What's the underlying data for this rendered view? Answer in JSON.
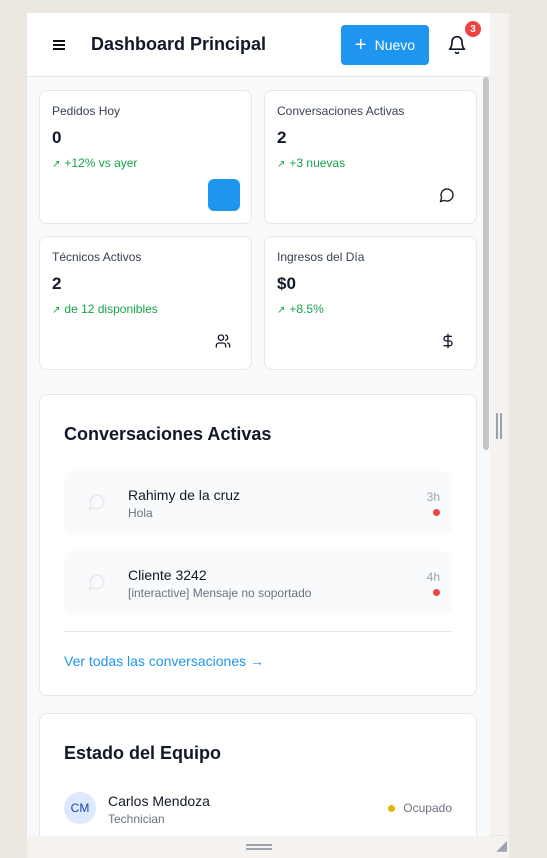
{
  "header": {
    "title": "Dashboard Principal",
    "new_button": "Nuevo",
    "notification_count": "3"
  },
  "stats": [
    {
      "label": "Pedidos Hoy",
      "value": "0",
      "trend": "+12% vs ayer",
      "icon": "blue-square-icon"
    },
    {
      "label": "Conversaciones Activas",
      "value": "2",
      "trend": "+3 nuevas",
      "icon": "message-circle-icon"
    },
    {
      "label": "Técnicos Activos",
      "value": "2",
      "trend": "de 12 disponibles",
      "icon": "users-icon"
    },
    {
      "label": "Ingresos del Día",
      "value": "$0",
      "trend": "+8.5%",
      "icon": "dollar-icon"
    }
  ],
  "conversations": {
    "title": "Conversaciones Activas",
    "items": [
      {
        "name": "Rahimy de la cruz",
        "message": "Hola",
        "time": "3h"
      },
      {
        "name": "Cliente 3242",
        "message": "[interactive] Mensaje no soportado",
        "time": "4h"
      }
    ],
    "view_all": "Ver todas las conversaciones →"
  },
  "team": {
    "title": "Estado del Equipo",
    "members": [
      {
        "initials": "CM",
        "name": "Carlos Mendoza",
        "role": "Technician",
        "status": "Ocupado"
      }
    ]
  },
  "colors": {
    "accent": "#1e96f0",
    "trend_green": "#16a34a",
    "unread_red": "#ef4444",
    "busy_yellow": "#eab308"
  }
}
